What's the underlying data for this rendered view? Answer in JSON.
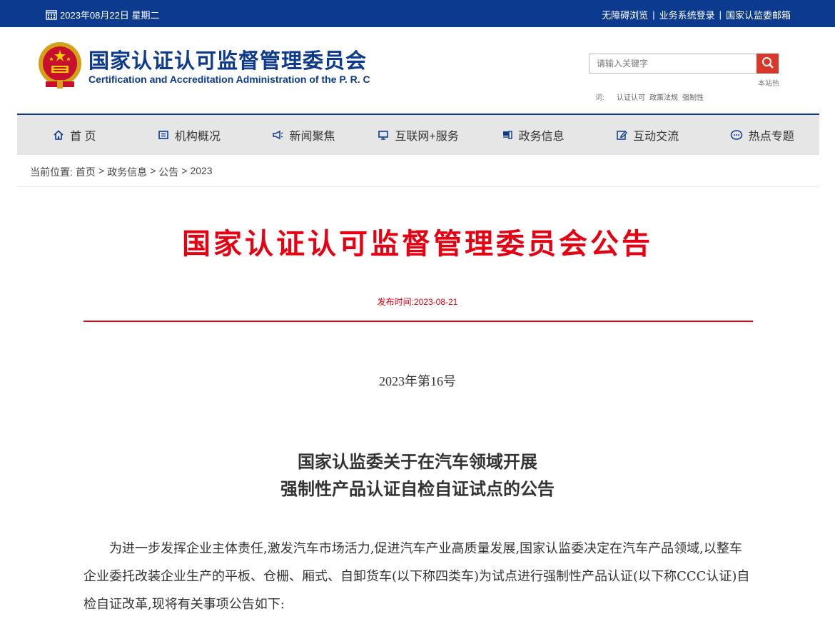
{
  "topbar": {
    "date": "2023年08月22日 星期二",
    "links": [
      "无障碍浏览",
      "业务系统登录",
      "国家认监委邮箱"
    ],
    "separator": "|"
  },
  "header": {
    "title": "国家认证认可监督管理委员会",
    "subtitle": "Certification and Accreditation Administration of the P. R. C",
    "search_placeholder": "请输入关键字",
    "hot_label_a": "本站热",
    "hot_label_b": "词:",
    "hot_words": [
      "认证认可",
      "政策法规",
      "强制性"
    ]
  },
  "nav": {
    "items": [
      {
        "label": "首 页",
        "icon": "home-icon"
      },
      {
        "label": "机构概况",
        "icon": "building-icon"
      },
      {
        "label": "新闻聚焦",
        "icon": "megaphone-icon"
      },
      {
        "label": "互联网+服务",
        "icon": "monitor-icon"
      },
      {
        "label": "政务信息",
        "icon": "document-icon"
      },
      {
        "label": "互动交流",
        "icon": "edit-icon"
      },
      {
        "label": "热点专题",
        "icon": "chat-icon"
      }
    ]
  },
  "breadcrumb": {
    "prefix": "当前位置:",
    "items": [
      "首页",
      "政务信息",
      "公告",
      "2023"
    ],
    "sep": ">"
  },
  "article": {
    "title": "国家认证认可监督管理委员会公告",
    "pub_date": "发布时间:2023-08-21",
    "doc_number": "2023年第16号",
    "doc_title_line1": "国家认监委关于在汽车领域开展",
    "doc_title_line2": "强制性产品认证自检自证试点的公告",
    "paragraph1": "为进一步发挥企业主体责任,激发汽车市场活力,促进汽车产业高质量发展,国家认监委决定在汽车产品领域,以整车企业委托改装企业生产的平板、仓栅、厢式、自卸货车(以下称四类车)为试点进行强制性产品认证(以下称CCC认证)自检自证改革,现将有关事项公告如下:"
  },
  "colors": {
    "brand_blue": "#0c3a8e",
    "accent_red": "#e60012",
    "search_red": "#d8372c",
    "nav_bg": "#e6e6e6"
  }
}
